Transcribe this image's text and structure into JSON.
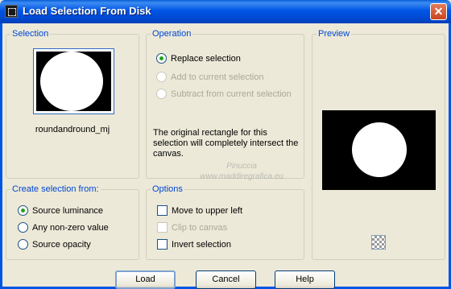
{
  "window": {
    "title": "Load Selection From Disk",
    "close_glyph": "✕"
  },
  "selection": {
    "label": "Selection",
    "filename": "roundandround_mj"
  },
  "operation": {
    "label": "Operation",
    "options": [
      {
        "label": "Replace selection",
        "checked": true,
        "enabled": true
      },
      {
        "label": "Add to current selection",
        "checked": false,
        "enabled": false
      },
      {
        "label": "Subtract from current selection",
        "checked": false,
        "enabled": false
      }
    ],
    "info": "The original rectangle for this selection will completely intersect the canvas."
  },
  "preview": {
    "label": "Preview"
  },
  "create_from": {
    "label": "Create selection from:",
    "options": [
      {
        "label": "Source luminance",
        "checked": true
      },
      {
        "label": "Any non-zero value",
        "checked": false
      },
      {
        "label": "Source opacity",
        "checked": false
      }
    ]
  },
  "options": {
    "label": "Options",
    "items": [
      {
        "label": "Move to upper left",
        "checked": false,
        "enabled": true
      },
      {
        "label": "Clip to canvas",
        "checked": false,
        "enabled": false
      },
      {
        "label": "Invert selection",
        "checked": false,
        "enabled": true
      }
    ]
  },
  "watermark": {
    "line1": "Pinuccia",
    "line2": "www.maddiregrafica.eu"
  },
  "buttons": {
    "load": "Load",
    "cancel": "Cancel",
    "help": "Help"
  },
  "colors": {
    "titlebar": "#0055e5",
    "group_label": "#0046d5",
    "dialog_bg": "#ece9d8"
  }
}
